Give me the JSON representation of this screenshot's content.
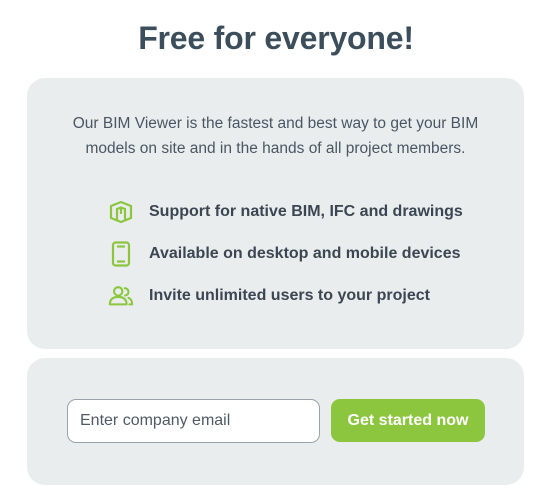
{
  "header": {
    "title": "Free for everyone!"
  },
  "features_card": {
    "intro": "Our BIM Viewer is the fastest and best way to get your BIM models on site and in the hands of all project members.",
    "items": [
      {
        "icon": "bim-model-icon",
        "label": "Support for native BIM, IFC and drawings"
      },
      {
        "icon": "mobile-device-icon",
        "label": "Available on desktop and mobile devices"
      },
      {
        "icon": "users-icon",
        "label": "Invite unlimited users to your project"
      }
    ]
  },
  "signup": {
    "email_placeholder": "Enter company email",
    "email_value": "",
    "button_label": "Get started now"
  },
  "colors": {
    "accent": "#8cc63f",
    "card_background": "#eaedee",
    "title": "#3c4e5c"
  }
}
